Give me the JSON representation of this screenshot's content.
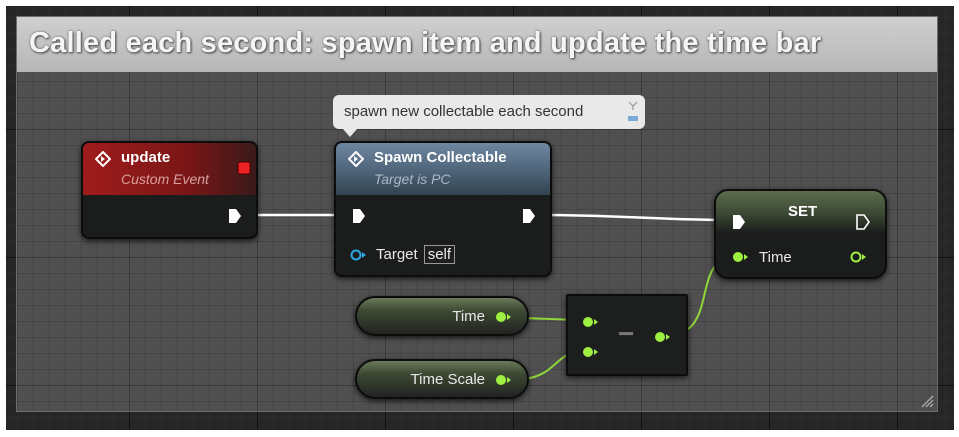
{
  "comment": {
    "title": "Called each second: spawn item and update the time bar"
  },
  "tooltip": {
    "text": "spawn new collectable each second"
  },
  "nodes": {
    "update_event": {
      "title": "update",
      "subtitle": "Custom Event",
      "header_color": "#8b1a1a"
    },
    "spawn_collectable": {
      "title": "Spawn Collectable",
      "subtitle": "Target is PC",
      "target_label": "Target",
      "target_value": "self",
      "header_color": "#3d5366"
    },
    "set_node": {
      "title": "SET",
      "pin_label": "Time"
    },
    "time_var": {
      "label": "Time"
    },
    "time_scale_var": {
      "label": "Time Scale"
    },
    "subtract_node": {
      "operator": "−"
    }
  },
  "colors": {
    "float_pin": "#9ef041",
    "object_pin": "#2aa8e0",
    "exec_pin": "#ffffff",
    "event_red": "#d11",
    "wire_exec": "#ffffff",
    "wire_float": "#8fd63a"
  }
}
